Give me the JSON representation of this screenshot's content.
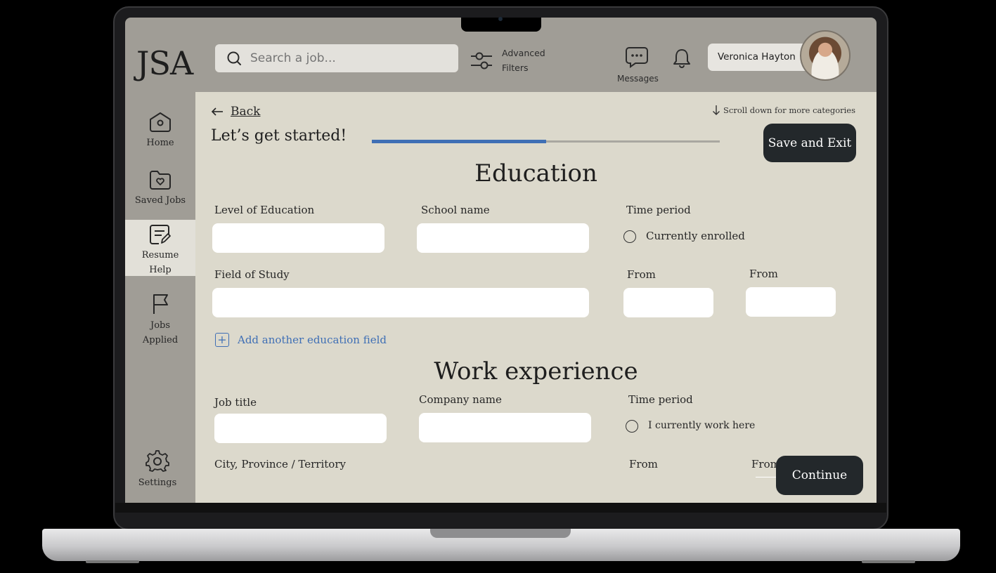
{
  "app": {
    "logo": "JSA",
    "search_placeholder": "Search a job...",
    "advanced_filters_line1": "Advanced",
    "advanced_filters_line2": "Filters",
    "messages_label": "Messages",
    "user_name": "Veronica Hayton"
  },
  "sidebar": {
    "items": [
      {
        "label": "Home",
        "icon": "home-icon"
      },
      {
        "label": "Saved Jobs",
        "icon": "saved-folder-icon"
      },
      {
        "label_line1": "Resume",
        "label_line2": "Help",
        "icon": "resume-edit-icon",
        "active": true
      },
      {
        "label_line1": "Jobs",
        "label_line2": "Applied",
        "icon": "flag-icon"
      },
      {
        "label": "Settings",
        "icon": "gear-icon"
      }
    ]
  },
  "page": {
    "back_label": "Back",
    "scroll_hint": "Scroll down for more categories",
    "heading": "Let’s get started!",
    "progress": 0.5,
    "save_exit_label": "Save and Exit",
    "continue_label": "Continue"
  },
  "education": {
    "title": "Education",
    "level_label": "Level of Education",
    "school_label": "School name",
    "time_period_label": "Time period",
    "enrolled_label": "Currently enrolled",
    "field_label": "Field of Study",
    "from_label_1": "From",
    "from_label_2": "From",
    "add_label": "Add another education field"
  },
  "work": {
    "title": "Work experience",
    "job_title_label": "Job title",
    "company_label": "Company name",
    "time_period_label": "Time period",
    "current_label": "I currently work here",
    "city_label": "City, Province / Territory",
    "from_label_1": "From",
    "from_label_2": "From"
  },
  "colors": {
    "accent": "#3f6fb5",
    "dark_button": "#23282b",
    "panel": "#dcd9cc",
    "chrome": "#a09d96"
  }
}
